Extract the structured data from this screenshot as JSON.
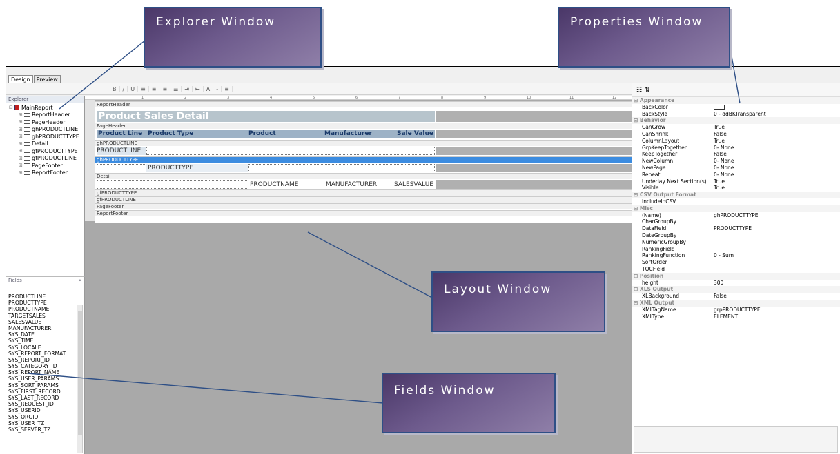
{
  "callouts": {
    "explorer": "Explorer Window",
    "properties": "Properties Window",
    "layout": "Layout Window",
    "fields": "Fields Window"
  },
  "mode_tabs": [
    "Design",
    "Preview"
  ],
  "toolbar": {
    "items": [
      "B",
      "/",
      "U",
      "≡",
      "≡",
      "≡",
      "☰",
      "⇥",
      "⇤",
      "A",
      "-",
      "≡"
    ]
  },
  "explorer": {
    "title": "Explorer",
    "root": "MainReport",
    "items": [
      "ReportHeader",
      "PageHeader",
      "ghPRODUCTLINE",
      "ghPRODUCTTYPE",
      "Detail",
      "gfPRODUCTTYPE",
      "gfPRODUCTLINE",
      "PageFooter",
      "ReportFooter"
    ]
  },
  "fields": {
    "title": "Fields",
    "close": "×",
    "items": [
      "PRODUCTLINE",
      "PRODUCTTYPE",
      "PRODUCTNAME",
      "TARGETSALES",
      "SALESVALUE",
      "MANUFACTURER",
      "SYS_DATE",
      "SYS_TIME",
      "SYS_LOCALE",
      "SYS_REPORT_FORMAT",
      "SYS_REPORT_ID",
      "SYS_CATEGORY_ID",
      "SYS_REPORT_NAME",
      "SYS_USER_PARAMS",
      "SYS_SORT_PARAMS",
      "SYS_FIRST_RECORD",
      "SYS_LAST_RECORD",
      "SYS_REQUEST_ID",
      "SYS_USERID",
      "SYS_ORGID",
      "SYS_USER_TZ",
      "SYS_SERVER_TZ"
    ]
  },
  "layout": {
    "ruler_marks": [
      "1",
      "2",
      "3",
      "4",
      "5",
      "6",
      "7",
      "8",
      "9",
      "10",
      "11",
      "12"
    ],
    "bands": {
      "report_header": "ReportHeader",
      "page_header": "PageHeader",
      "gh_line": "ghPRODUCTLINE",
      "gh_type": "ghPRODUCTTYPE",
      "detail": "Detail",
      "gf_type": "gfPRODUCTTYPE",
      "gf_line": "gfPRODUCTLINE",
      "page_footer": "PageFooter",
      "report_footer": "ReportFooter"
    },
    "title": "Product Sales Detail",
    "columns": [
      "Product Line",
      "Product Type",
      "Product",
      "Manufacturer",
      "Sale Value"
    ],
    "line_field": "PRODUCTLINE",
    "type_field": "PRODUCTTYPE",
    "detail_fields": [
      "PRODUCTNAME",
      "MANUFACTURER",
      "SALESVALUE"
    ]
  },
  "properties": {
    "categories": [
      {
        "name": "Appearance",
        "rows": [
          [
            "BackColor",
            ""
          ],
          [
            "BackStyle",
            "0 - ddBKTransparent"
          ]
        ]
      },
      {
        "name": "Behavior",
        "rows": [
          [
            "CanGrow",
            "True"
          ],
          [
            "CanShrink",
            "False"
          ],
          [
            "ColumnLayout",
            "True"
          ],
          [
            "GrpKeepTogether",
            "0- None"
          ],
          [
            "KeepTogether",
            "False"
          ],
          [
            "NewColumn",
            "0- None"
          ],
          [
            "NewPage",
            "0- None"
          ],
          [
            "Repeat",
            "0- None"
          ],
          [
            "Underlay Next Section(s)",
            "True"
          ],
          [
            "Visible",
            "True"
          ]
        ]
      },
      {
        "name": "CSV Output Format",
        "rows": [
          [
            "IncludeInCSV",
            ""
          ]
        ]
      },
      {
        "name": "Misc",
        "rows": [
          [
            "(Name)",
            "ghPRODUCTTYPE"
          ],
          [
            "CharGroupBy",
            ""
          ],
          [
            "DataField",
            "PRODUCTTYPE"
          ],
          [
            "DateGroupBy",
            ""
          ],
          [
            "NumericGroupBy",
            ""
          ],
          [
            "RankingField",
            ""
          ],
          [
            "RankingFunction",
            "0 - Sum"
          ],
          [
            "SortOrder",
            ""
          ],
          [
            "TOCField",
            ""
          ]
        ]
      },
      {
        "name": "Position",
        "rows": [
          [
            "height",
            "300"
          ]
        ]
      },
      {
        "name": "XLS Output",
        "rows": [
          [
            "XLBackground",
            "False"
          ]
        ]
      },
      {
        "name": "XML Output",
        "rows": [
          [
            "XMLTagName",
            "grpPRODUCTTYPE"
          ],
          [
            "XMLType",
            "ELEMENT"
          ]
        ]
      }
    ]
  }
}
